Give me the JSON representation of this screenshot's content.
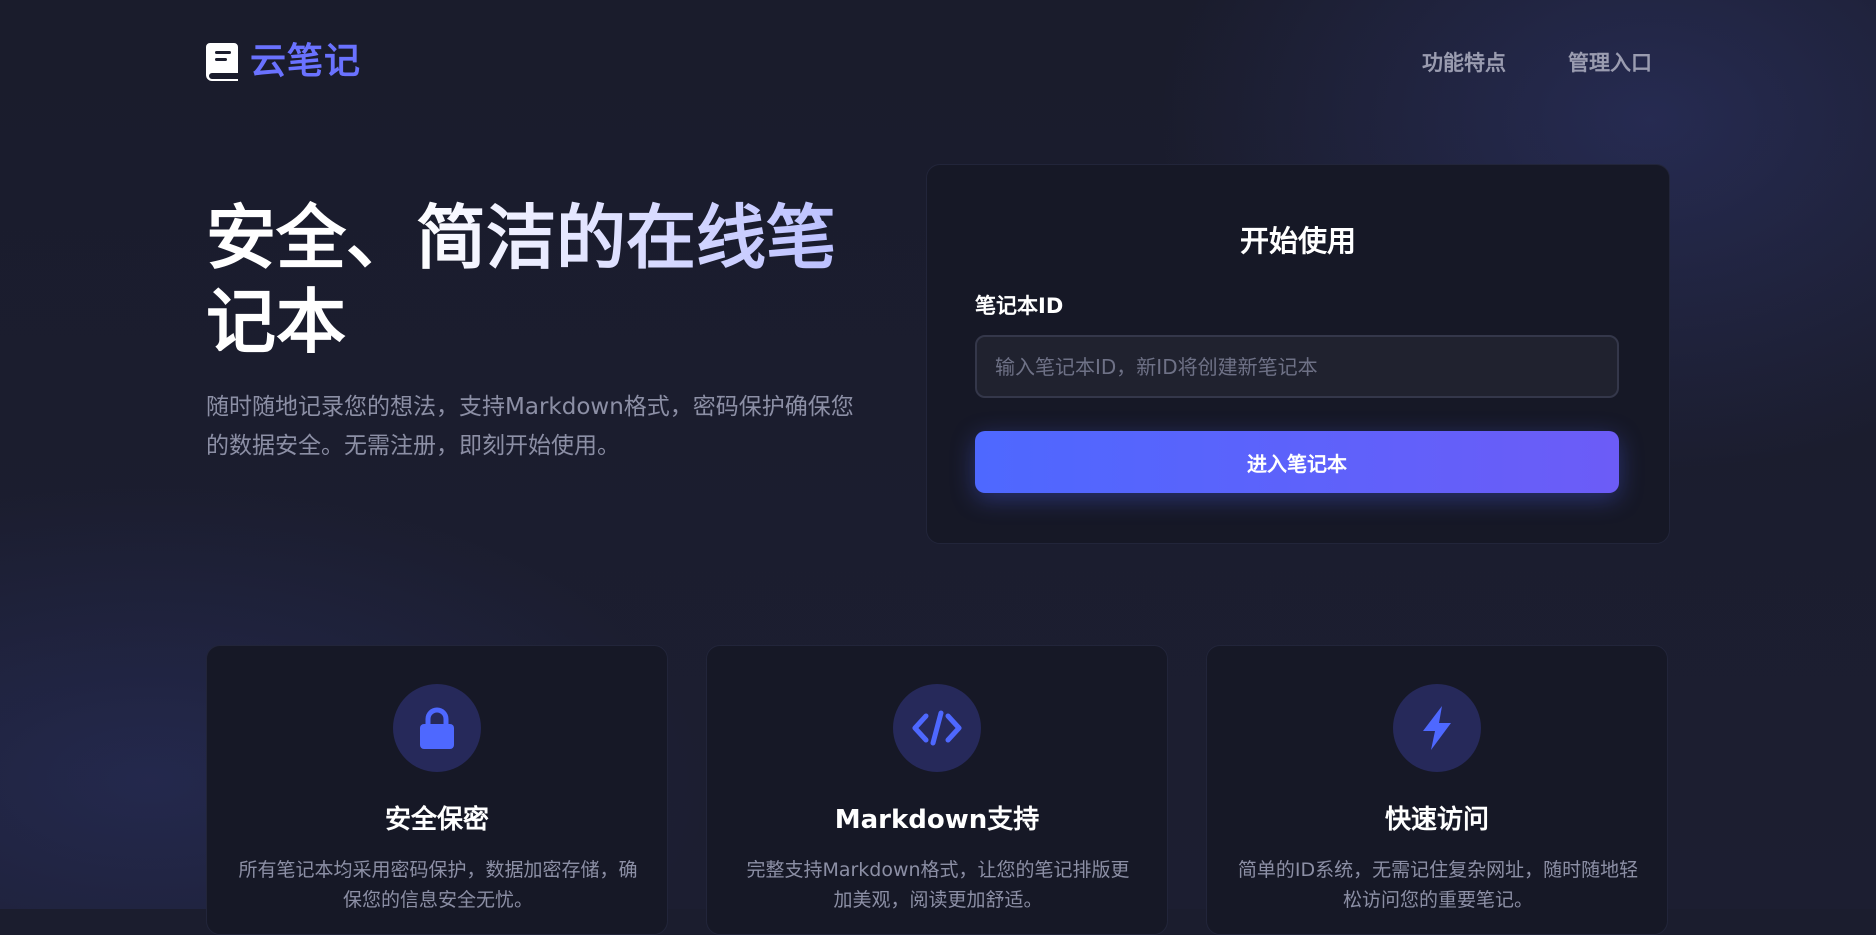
{
  "brand": {
    "name": "云笔记",
    "accent_color": "#6a72ff",
    "logo_icon": "book-icon"
  },
  "nav": {
    "items": [
      {
        "label": "功能特点"
      },
      {
        "label": "管理入口"
      }
    ]
  },
  "hero": {
    "title_line1": "安全、简洁的在线笔",
    "title_line2": "记本",
    "subtitle": "随时随地记录您的想法，支持Markdown格式，密码保护确保您的数据安全。无需注册，即刻开始使用。"
  },
  "start": {
    "title": "开始使用",
    "id_label": "笔记本ID",
    "id_placeholder": "输入笔记本ID，新ID将创建新笔记本",
    "id_value": "",
    "button_label": "进入笔记本",
    "button_gradient": [
      "#4e68ff",
      "#6c5cf7"
    ]
  },
  "features": [
    {
      "icon": "lock-icon",
      "title": "安全保密",
      "desc": "所有笔记本均采用密码保护，数据加密存储，确保您的信息安全无忧。"
    },
    {
      "icon": "code-icon",
      "title": "Markdown支持",
      "desc": "完整支持Markdown格式，让您的笔记排版更加美观，阅读更加舒适。"
    },
    {
      "icon": "lightning-icon",
      "title": "快速访问",
      "desc": "简单的ID系统，无需记住复杂网址，随时随地轻松访问您的重要笔记。"
    }
  ],
  "colors": {
    "background": "#1b1d2e",
    "card": "#161826",
    "icon_circle": "#26295a",
    "icon_fg": "#4e68ff",
    "muted_text": "#8c8fa5"
  }
}
